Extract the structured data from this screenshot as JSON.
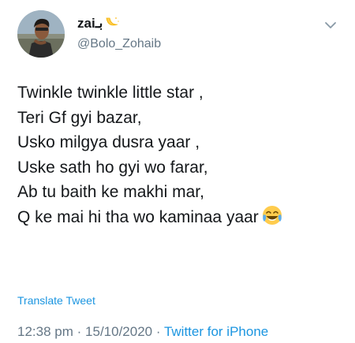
{
  "user": {
    "display_name": "zaiبـ",
    "handle": "@Bolo_Zohaib"
  },
  "tweet": {
    "lines": [
      "Twinkle twinkle little star ,",
      "Teri Gf gyi bazar,",
      "Usko milgya dusra yaar ,",
      "Uske sath ho gyi wo farar,",
      "Ab tu baith ke makhi mar,",
      "Q ke mai hi tha wo kaminaa yaar"
    ],
    "translate_label": "Translate Tweet",
    "time": "12:38 pm",
    "separator": "·",
    "date": "15/10/2020",
    "source": "Twitter for iPhone"
  },
  "icons": {
    "name_emoji": "crescent-moon-emoji",
    "laugh_emoji": "face-with-tears-of-joy-emoji",
    "caret": "chevron-down-icon"
  },
  "colors": {
    "text": "#14171a",
    "secondary": "#657786",
    "link": "#1b95e0",
    "emoji": "#ffcc4d"
  }
}
